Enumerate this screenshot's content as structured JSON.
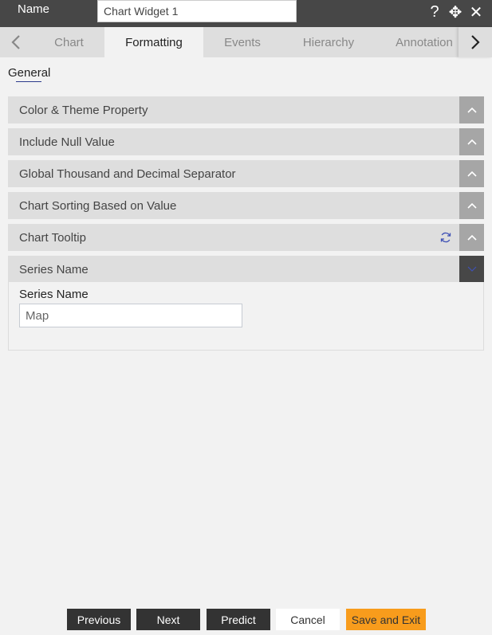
{
  "header": {
    "name_label": "Name",
    "name_value": "Chart Widget 1",
    "icons": [
      "help-icon",
      "move-icon",
      "close-icon"
    ],
    "help_glyph": "?",
    "move_glyph": "✥",
    "close_glyph": "✕"
  },
  "tabs": {
    "prev_glyph": "‹",
    "next_glyph": "›",
    "items": [
      {
        "label": "Chart",
        "active": false
      },
      {
        "label": "Formatting",
        "active": true
      },
      {
        "label": "Events",
        "active": false
      },
      {
        "label": "Hierarchy",
        "active": false
      },
      {
        "label": "Annotation",
        "active": false
      }
    ]
  },
  "section": {
    "label": "General"
  },
  "accordions": [
    {
      "title": "Color & Theme Property",
      "expanded": false
    },
    {
      "title": "Include Null Value",
      "expanded": false
    },
    {
      "title": "Global Thousand and Decimal Separator",
      "expanded": false
    },
    {
      "title": "Chart Sorting Based on Value",
      "expanded": false
    },
    {
      "title": "Chart Tooltip",
      "expanded": false,
      "has_refresh": true
    },
    {
      "title": "Series Name",
      "expanded": true
    }
  ],
  "series_name_panel": {
    "field_label": "Series Name",
    "field_value": "Map"
  },
  "footer": {
    "previous": "Previous",
    "next": "Next",
    "predict": "Predict",
    "cancel": "Cancel",
    "save_exit": "Save and Exit"
  },
  "colors": {
    "accent_orange": "#f89c1c",
    "header_dark": "#474747",
    "refresh_blue": "#3f51b5"
  }
}
